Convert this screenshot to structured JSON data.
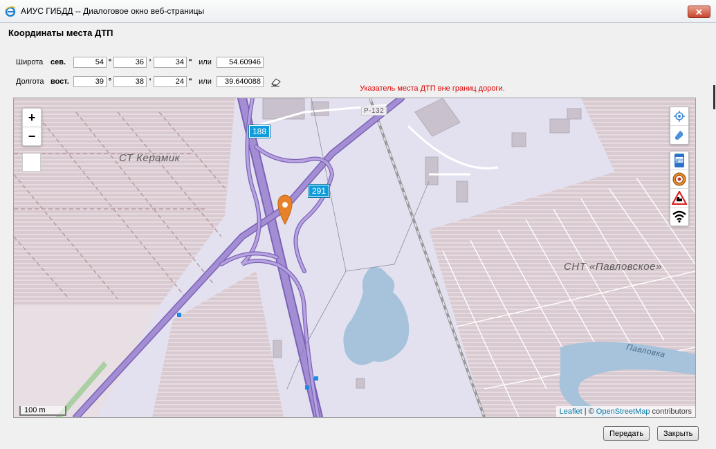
{
  "window": {
    "title": "АИУС ГИБДД -- Диалоговое окно веб-страницы",
    "close_label": "✕"
  },
  "form": {
    "heading": "Координаты места ДТП",
    "latitude": {
      "label": "Широта",
      "direction": "сев.",
      "deg": "54",
      "min": "36",
      "sec": "34",
      "or_label": "или",
      "decimal": "54.60946"
    },
    "longitude": {
      "label": "Долгота",
      "direction": "вост.",
      "deg": "39",
      "min": "38",
      "sec": "24",
      "or_label": "или",
      "decimal": "39.640088"
    },
    "units": {
      "deg": "°",
      "min": "'",
      "sec": "\""
    },
    "warning": "Указатель места ДТП вне границ дороги."
  },
  "map": {
    "zoom_in": "+",
    "zoom_out": "−",
    "labels": {
      "st_keramik": "СТ Керамик",
      "snt_pavlovskoe": "СНТ «Павловское»",
      "pavlovka": "Павловка",
      "road_p132": "Р-132",
      "shield_188": "188",
      "shield_291": "291"
    },
    "scale": "100 m",
    "attribution": {
      "leaflet": "Leaflet",
      "sep": "| ©",
      "osm": "OpenStreetMap",
      "contributors": "contributors"
    },
    "controls": [
      "locate-icon",
      "layers-icon",
      "dps-icon",
      "gibdd-emblem-icon",
      "railway-crossing-sign-icon",
      "wifi-icon"
    ],
    "colors": {
      "residential": "#d8c8cf",
      "road": "#a38ed3",
      "water": "#a6c3db",
      "marker": "#e8822a"
    }
  },
  "buttons": {
    "submit": "Передать",
    "close": "Закрыть"
  }
}
